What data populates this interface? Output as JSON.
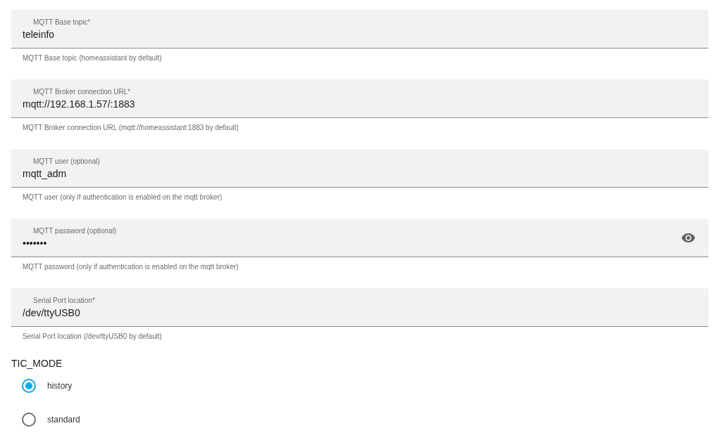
{
  "fields": [
    {
      "kind": "text",
      "label": "MQTT Base topic*",
      "value": "teleinfo",
      "helper": "MQTT Base topic (homeassistant by default)"
    },
    {
      "kind": "text",
      "label": "MQTT Broker connection URL*",
      "value": "mqtt://192.168.1.57/:1883",
      "helper": "MQTT Broker connection URL (mqtt://homeassistant:1883 by default)"
    },
    {
      "kind": "text",
      "label": "MQTT user (optional)",
      "value": "mqtt_adm",
      "helper": "MQTT user (only if authentication is enabled on the mqtt broker)"
    },
    {
      "kind": "password",
      "label": "MQTT password (optional)",
      "value": "•••••••",
      "helper": "MQTT password (only if authentication is enabled on the mqtt broker)"
    },
    {
      "kind": "text",
      "label": "Serial Port location*",
      "value": "/dev/ttyUSB0",
      "helper": "Serial Port location (/dev/ttyUSB0 by default)"
    }
  ],
  "tic_mode": {
    "label": "TIC_MODE",
    "options": [
      {
        "label": "history",
        "selected": true
      },
      {
        "label": "standard",
        "selected": false
      }
    ]
  }
}
